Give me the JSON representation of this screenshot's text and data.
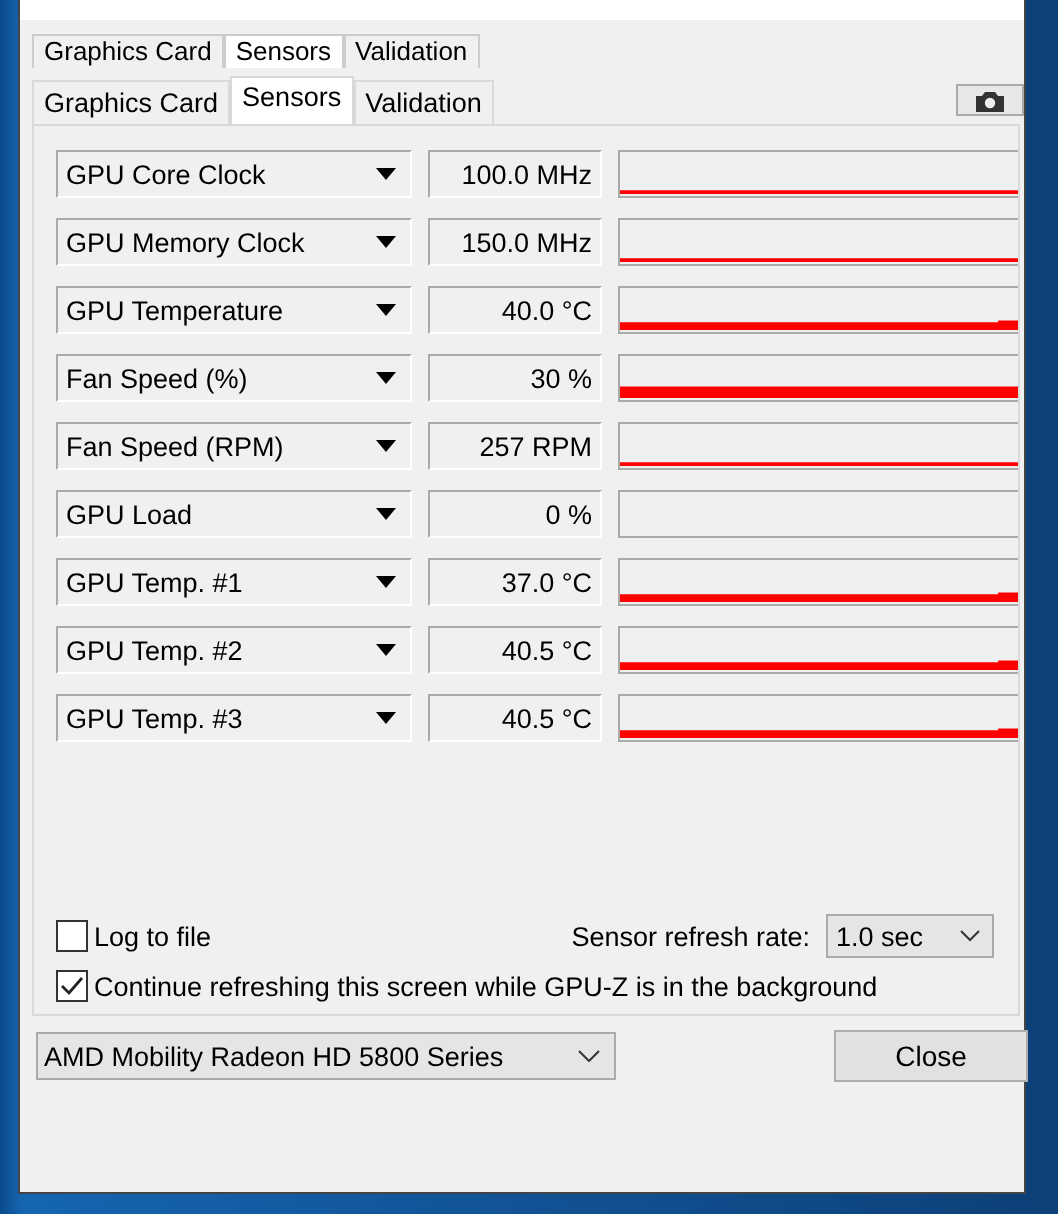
{
  "background_tabs": [
    {
      "label": "Graphics Card",
      "selected": false
    },
    {
      "label": "Sensors",
      "selected": true
    },
    {
      "label": "Validation",
      "selected": false
    }
  ],
  "tabs": [
    {
      "label": "Graphics Card",
      "selected": false
    },
    {
      "label": "Sensors",
      "selected": true
    },
    {
      "label": "Validation",
      "selected": false
    }
  ],
  "sensors": [
    {
      "name": "GPU Core Clock",
      "reading": "100.0 MHz",
      "kind": "line"
    },
    {
      "name": "GPU Memory Clock",
      "reading": "150.0 MHz",
      "kind": "line"
    },
    {
      "name": "GPU Temperature",
      "reading": "40.0 °C",
      "kind": "band"
    },
    {
      "name": "Fan Speed (%)",
      "reading": "30 %",
      "kind": "wide"
    },
    {
      "name": "Fan Speed (RPM)",
      "reading": "257 RPM",
      "kind": "line"
    },
    {
      "name": "GPU Load",
      "reading": "0 %",
      "kind": "none"
    },
    {
      "name": "GPU Temp. #1",
      "reading": "37.0 °C",
      "kind": "band"
    },
    {
      "name": "GPU Temp. #2",
      "reading": "40.5 °C",
      "kind": "band"
    },
    {
      "name": "GPU Temp. #3",
      "reading": "40.5 °C",
      "kind": "band"
    }
  ],
  "log_to_file": {
    "label": "Log to file",
    "checked": false
  },
  "refresh_rate": {
    "label": "Sensor refresh rate:",
    "value": "1.0 sec"
  },
  "continue_refreshing": {
    "label": "Continue refreshing this screen while GPU-Z is in the background",
    "checked": true
  },
  "gpu_select": {
    "value": "AMD Mobility Radeon HD 5800 Series"
  },
  "close_button": {
    "label": "Close"
  }
}
